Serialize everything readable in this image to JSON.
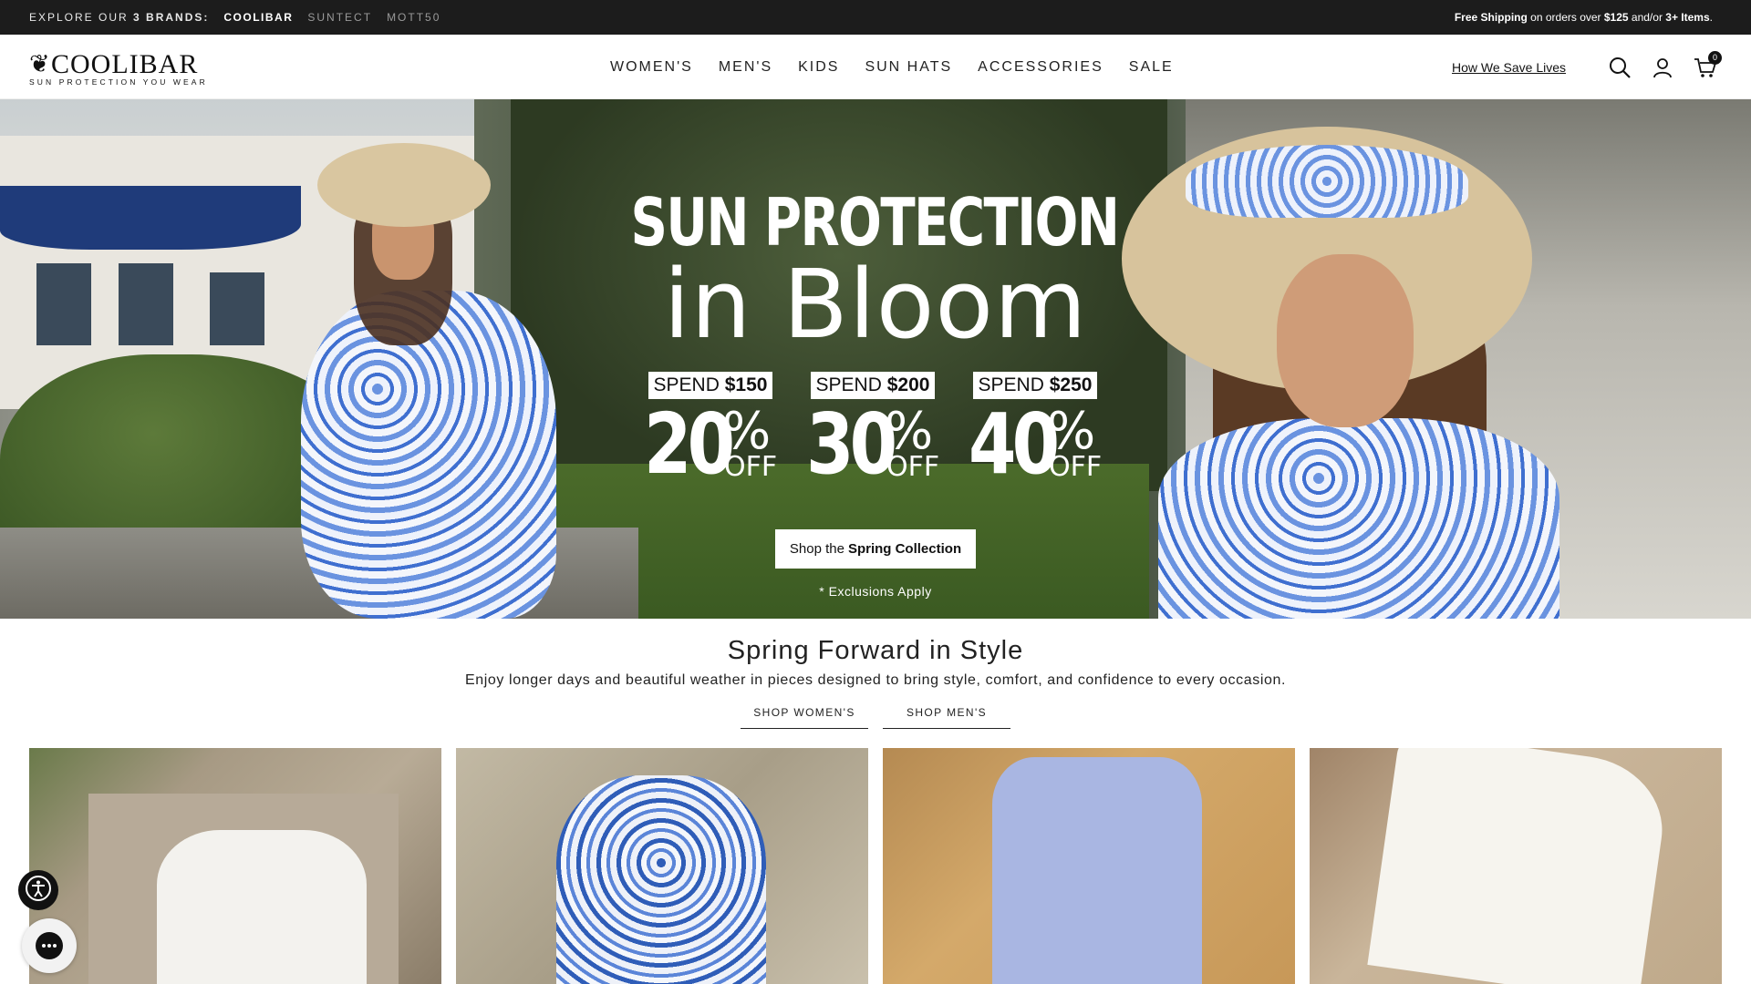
{
  "topbar": {
    "explore_label": "EXPLORE OUR",
    "brand_count": "3 BRANDS:",
    "brands": [
      "COOLIBAR",
      "SUNTECT",
      "MOTT50"
    ],
    "shipping": {
      "bold1": "Free Shipping",
      "text1": " on orders over ",
      "bold2": "$125",
      "text2": " and/or ",
      "bold3": "3+ Items",
      "text3": "."
    }
  },
  "header": {
    "logo_text": "COOLIBAR",
    "logo_tagline": "SUN PROTECTION YOU WEAR",
    "nav": [
      "WOMEN'S",
      "MEN'S",
      "KIDS",
      "SUN HATS",
      "ACCESSORIES",
      "SALE"
    ],
    "save_lives_link": "How We Save Lives",
    "cart_count": "0",
    "icons": [
      "search-icon",
      "account-icon",
      "cart-icon"
    ]
  },
  "hero": {
    "title_line1": "SUN PROTECTION",
    "title_line2": "in Bloom",
    "offers": [
      {
        "spend_label": "SPEND",
        "spend_amount": "$150",
        "percent": "20",
        "symbol": "%",
        "off": "OFF"
      },
      {
        "spend_label": "SPEND",
        "spend_amount": "$200",
        "percent": "30",
        "symbol": "%",
        "off": "OFF"
      },
      {
        "spend_label": "SPEND",
        "spend_amount": "$250",
        "percent": "40",
        "symbol": "%",
        "off": "OFF"
      }
    ],
    "cta_prefix": "Shop the",
    "cta_bold": "Spring Collection",
    "exclusions": "* Exclusions Apply"
  },
  "section": {
    "title": "Spring Forward in Style",
    "subtitle": "Enjoy longer days and beautiful weather in pieces designed to bring style, comfort, and confidence to every occasion.",
    "links": [
      "SHOP WOMEN'S",
      "SHOP MEN'S"
    ]
  },
  "colors": {
    "topbar_bg": "#1c1c1c",
    "accent_dress": "#3f6fd0"
  }
}
